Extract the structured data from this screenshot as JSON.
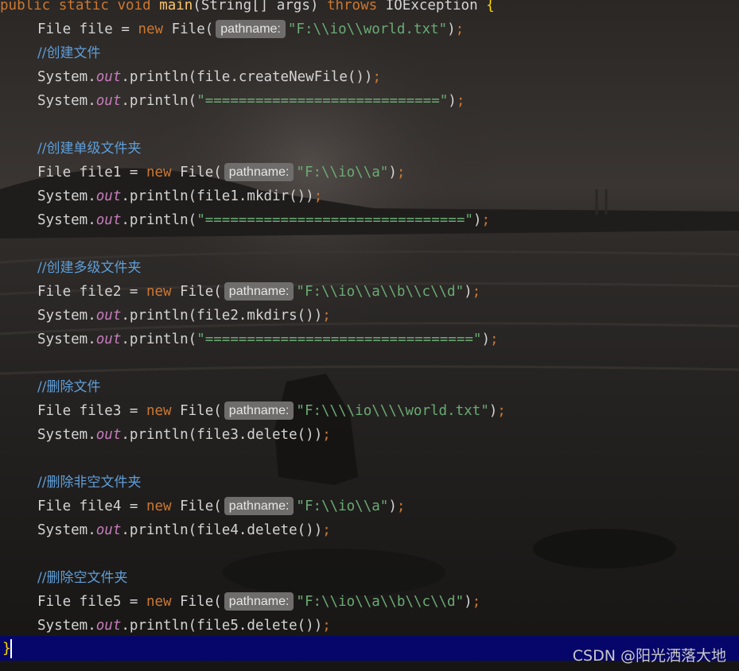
{
  "code": {
    "header": {
      "mods": "public static void",
      "method": "main",
      "params": "(String[] args)",
      "throws": "throws",
      "exc": "IOException",
      "brace": "{"
    },
    "hint_label": "pathname:",
    "comments": [
      "//创建文件",
      "//创建单级文件夹",
      "//创建多级文件夹",
      "//删除文件",
      "//删除非空文件夹",
      "//删除空文件夹"
    ],
    "decls": [
      {
        "lhs": "File file = ",
        "str": "\"F:\\\\io\\\\world.txt\""
      },
      {
        "lhs": "File file1 = ",
        "str": "\"F:\\\\io\\\\a\""
      },
      {
        "lhs": "File file2 = ",
        "str": "\"F:\\\\io\\\\a\\\\b\\\\c\\\\d\""
      },
      {
        "lhs": "File file3 = ",
        "str": "\"F:\\\\\\\\io\\\\\\\\world.txt\""
      },
      {
        "lhs": "File file4 = ",
        "str": "\"F:\\\\io\\\\a\""
      },
      {
        "lhs": "File file5 = ",
        "str": "\"F:\\\\io\\\\a\\\\b\\\\c\\\\d\""
      }
    ],
    "prints": {
      "p1": "file.createNewFile()",
      "p2": "\"============================\"",
      "p3": "file1.mkdir()",
      "p4": "\"===============================\"",
      "p5": "file2.mkdirs()",
      "p6": "\"================================\"",
      "p7": "file3.delete()",
      "p8": "file4.delete()",
      "p9": "file5.delete()"
    },
    "tokens": {
      "system": "System.",
      "out": "out",
      "println": ".println(",
      "close_paren": ")",
      "semi": ";",
      "kw_new": "new",
      "file_ctor": " File("
    },
    "closing_brace": "}"
  },
  "watermark": "CSDN @阳光洒落大地",
  "colors": {
    "keyword": "#cc7832",
    "method": "#ffc66d",
    "string": "#6aab73",
    "field": "#c77dbb",
    "comment": "#5f9ed8",
    "caret_line": "#06066a"
  }
}
